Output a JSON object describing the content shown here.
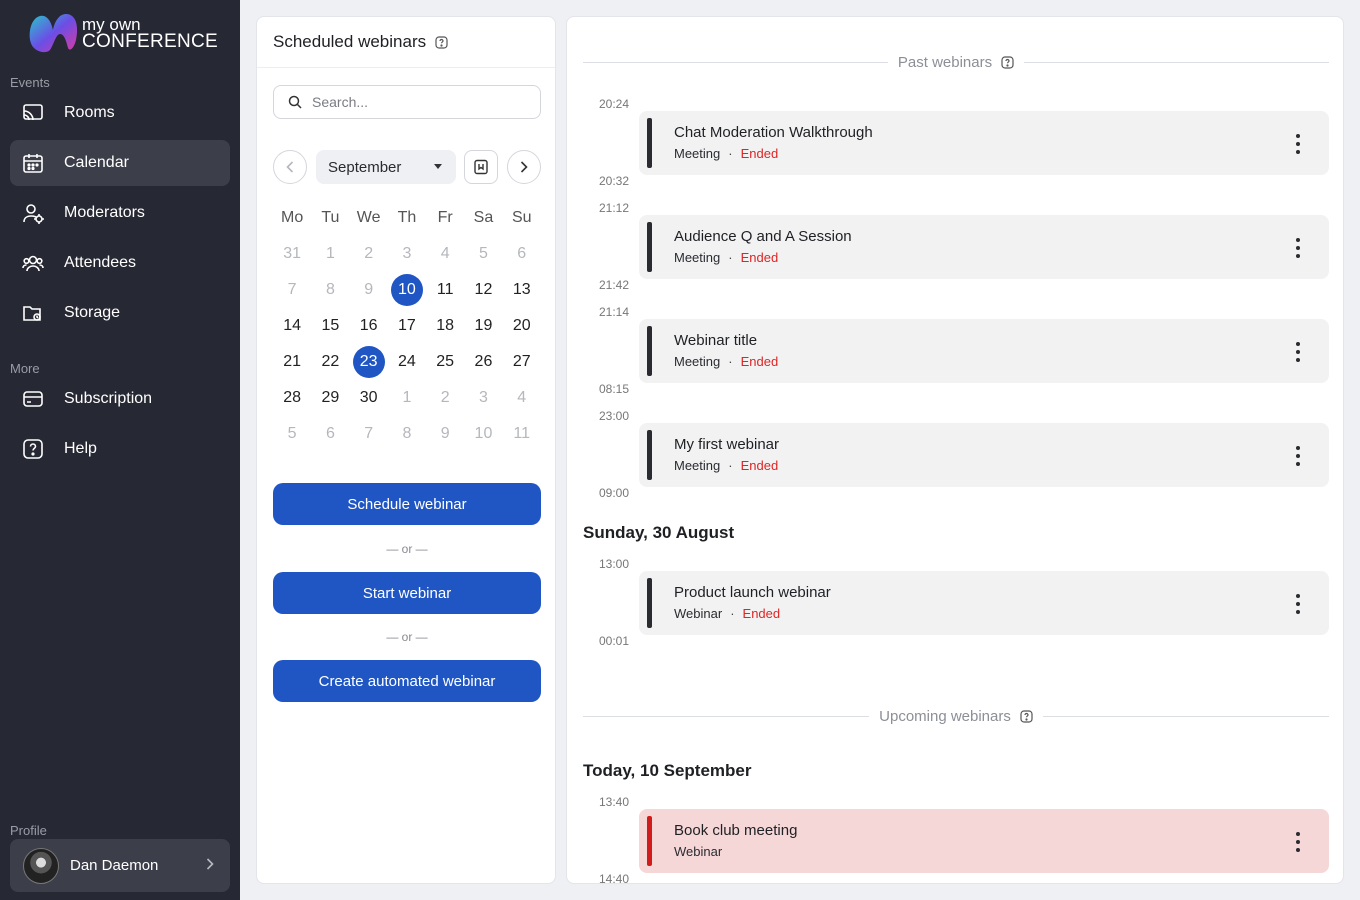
{
  "brand": {
    "line1": "my own",
    "line2": "CONFERENCE"
  },
  "sidebar": {
    "events_label": "Events",
    "more_label": "More",
    "profile_label": "Profile",
    "items": [
      {
        "label": "Rooms",
        "icon": "cast-icon"
      },
      {
        "label": "Calendar",
        "icon": "calendar-icon"
      },
      {
        "label": "Moderators",
        "icon": "moderator-icon"
      },
      {
        "label": "Attendees",
        "icon": "attendees-icon"
      },
      {
        "label": "Storage",
        "icon": "storage-icon"
      },
      {
        "label": "Subscription",
        "icon": "card-icon"
      },
      {
        "label": "Help",
        "icon": "help-icon"
      }
    ],
    "active_item": "Calendar",
    "profile_name": "Dan Daemon"
  },
  "scheduled": {
    "title": "Scheduled webinars",
    "search_placeholder": "Search...",
    "month": "September",
    "weekdays": [
      "Mo",
      "Tu",
      "We",
      "Th",
      "Fr",
      "Sa",
      "Su"
    ],
    "weeks": [
      [
        "31",
        "1",
        "2",
        "3",
        "4",
        "5",
        "6"
      ],
      [
        "7",
        "8",
        "9",
        "10",
        "11",
        "12",
        "13"
      ],
      [
        "14",
        "15",
        "16",
        "17",
        "18",
        "19",
        "20"
      ],
      [
        "21",
        "22",
        "23",
        "24",
        "25",
        "26",
        "27"
      ],
      [
        "28",
        "29",
        "30",
        "1",
        "2",
        "3",
        "4"
      ],
      [
        "5",
        "6",
        "7",
        "8",
        "9",
        "10",
        "11"
      ]
    ],
    "muted": [
      [
        0,
        0
      ],
      [
        0,
        1
      ],
      [
        0,
        2
      ],
      [
        0,
        3
      ],
      [
        0,
        4
      ],
      [
        0,
        5
      ],
      [
        0,
        6
      ],
      [
        1,
        0
      ],
      [
        1,
        1
      ],
      [
        1,
        2
      ],
      [
        4,
        3
      ],
      [
        4,
        4
      ],
      [
        4,
        5
      ],
      [
        4,
        6
      ],
      [
        5,
        0
      ],
      [
        5,
        1
      ],
      [
        5,
        2
      ],
      [
        5,
        3
      ],
      [
        5,
        4
      ],
      [
        5,
        5
      ],
      [
        5,
        6
      ]
    ],
    "selected": [
      [
        1,
        3
      ],
      [
        3,
        2
      ]
    ],
    "schedule_button": "Schedule webinar",
    "or_label": "— or —",
    "start_button": "Start webinar",
    "automated_button": "Create automated webinar"
  },
  "timeline": {
    "past_label": "Past webinars",
    "upcoming_label": "Upcoming webinars",
    "past_events": [
      {
        "start": "20:24",
        "end": "20:32",
        "title": "Chat Moderation Walkthrough",
        "type": "Meeting",
        "status": "Ended"
      },
      {
        "start": "21:12",
        "end": "21:42",
        "title": "Audience Q and A Session",
        "type": "Meeting",
        "status": "Ended"
      },
      {
        "start": "21:14",
        "end": "08:15",
        "title": "Webinar title",
        "type": "Meeting",
        "status": "Ended"
      },
      {
        "start": "23:00",
        "end": "09:00",
        "title": "My first webinar",
        "type": "Meeting",
        "status": "Ended"
      }
    ],
    "past_day": "Sunday, 30 August",
    "past_day_events": [
      {
        "start": "13:00",
        "end": "00:01",
        "title": "Product launch webinar",
        "type": "Webinar",
        "status": "Ended"
      }
    ],
    "upcoming_day": "Today, 10 September",
    "upcoming_events": [
      {
        "start": "13:40",
        "end": "14:40",
        "title": "Book club meeting",
        "type": "Webinar"
      }
    ],
    "colors": {
      "ended": "#e02424",
      "upcoming_bg": "#f6d7d8",
      "upcoming_bar": "#d21c1c",
      "primary": "#1f56c4"
    }
  }
}
